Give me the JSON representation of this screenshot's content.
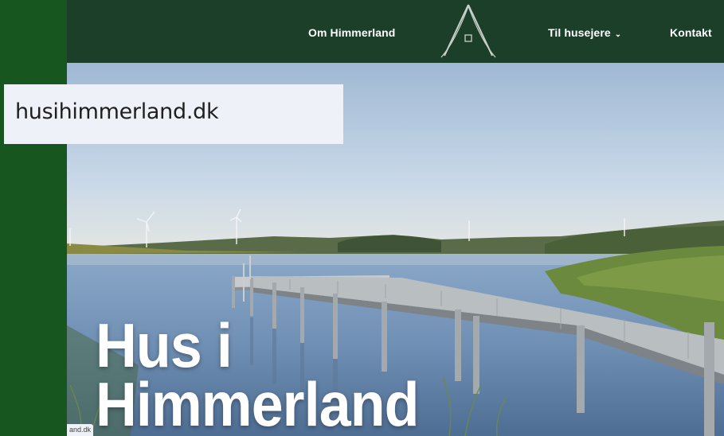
{
  "nav": {
    "about": "Om Himmerland",
    "owners": "Til husejere",
    "contact": "Kontakt"
  },
  "hero": {
    "title_line1": "Hus i",
    "title_line2": "Himmerland"
  },
  "overlay": {
    "domain": "husihimmerland.dk",
    "status_url": "and.dk"
  },
  "colors": {
    "nav_bg": "#1c3f29",
    "page_bg": "#17561f",
    "text": "#ffffff"
  },
  "icons": [
    "house-logo-icon",
    "chevron-down-icon",
    "wind-turbine-icon"
  ]
}
